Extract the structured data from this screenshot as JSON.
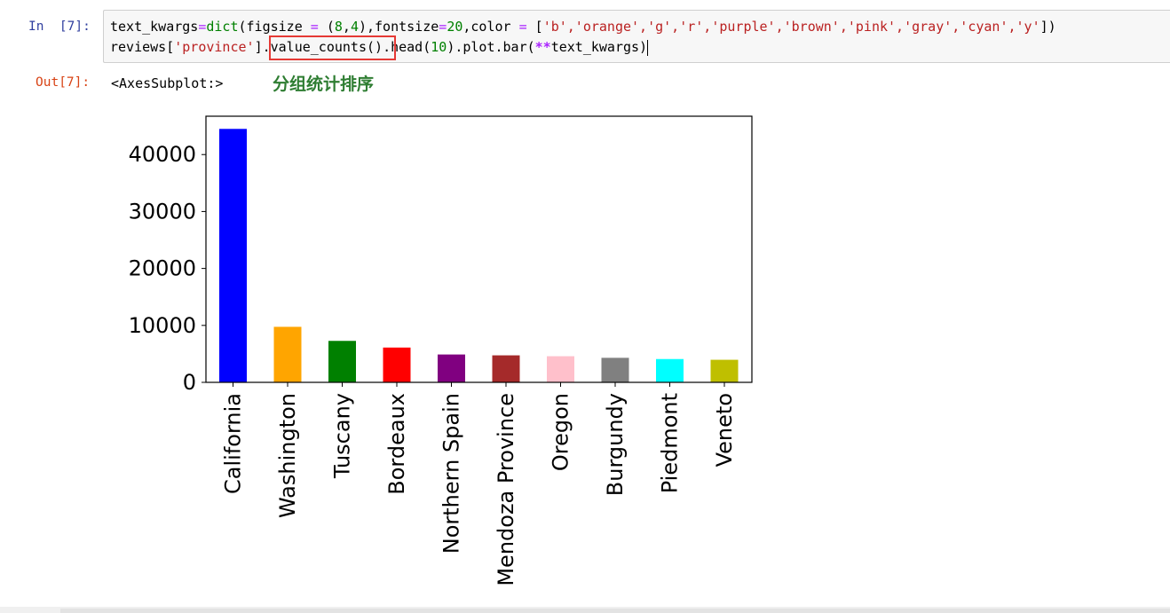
{
  "input_prompt": "In  [7]:",
  "output_prompt": "Out[7]:",
  "code": {
    "line1_var": "text_kwargs",
    "line1_eq": "=",
    "line1_dict": "dict",
    "line1_args_a": "(figsize ",
    "line1_eq2": "=",
    "line1_args_b": " (",
    "line1_n1": "8",
    "line1_comma1": ",",
    "line1_n2": "4",
    "line1_args_c": "),fontsize",
    "line1_eq3": "=",
    "line1_n3": "20",
    "line1_args_d": ",color ",
    "line1_eq4": "=",
    "line1_args_e": " [",
    "line1_colors": "'b','orange','g','r','purple','brown','pink','gray','cyan','y'",
    "line1_end": "])",
    "line2_a": "reviews[",
    "line2_str": "'province'",
    "line2_b": "]",
    "line2_c": ".value_counts()",
    "line2_d": ".head(",
    "line2_n": "10",
    "line2_e": ").plot.bar(",
    "line2_op": "**",
    "line2_f": "text_kwargs)"
  },
  "output_text": "<AxesSubplot:>",
  "annotation": "分组统计排序",
  "chart_data": {
    "type": "bar",
    "categories": [
      "California",
      "Washington",
      "Tuscany",
      "Bordeaux",
      "Northern Spain",
      "Mendoza Province",
      "Oregon",
      "Burgundy",
      "Piedmont",
      "Veneto"
    ],
    "values": [
      44508,
      9750,
      7281,
      6111,
      4892,
      4742,
      4589,
      4308,
      4093,
      3962
    ],
    "colors": [
      "#0000ff",
      "#ffa500",
      "#008000",
      "#ff0000",
      "#800080",
      "#a52a2a",
      "#ffc0cb",
      "#808080",
      "#00ffff",
      "#bfbf00"
    ],
    "yticks": [
      0,
      10000,
      20000,
      30000,
      40000
    ],
    "ylim": [
      0,
      46734
    ],
    "title": "",
    "xlabel": "",
    "ylabel": ""
  }
}
